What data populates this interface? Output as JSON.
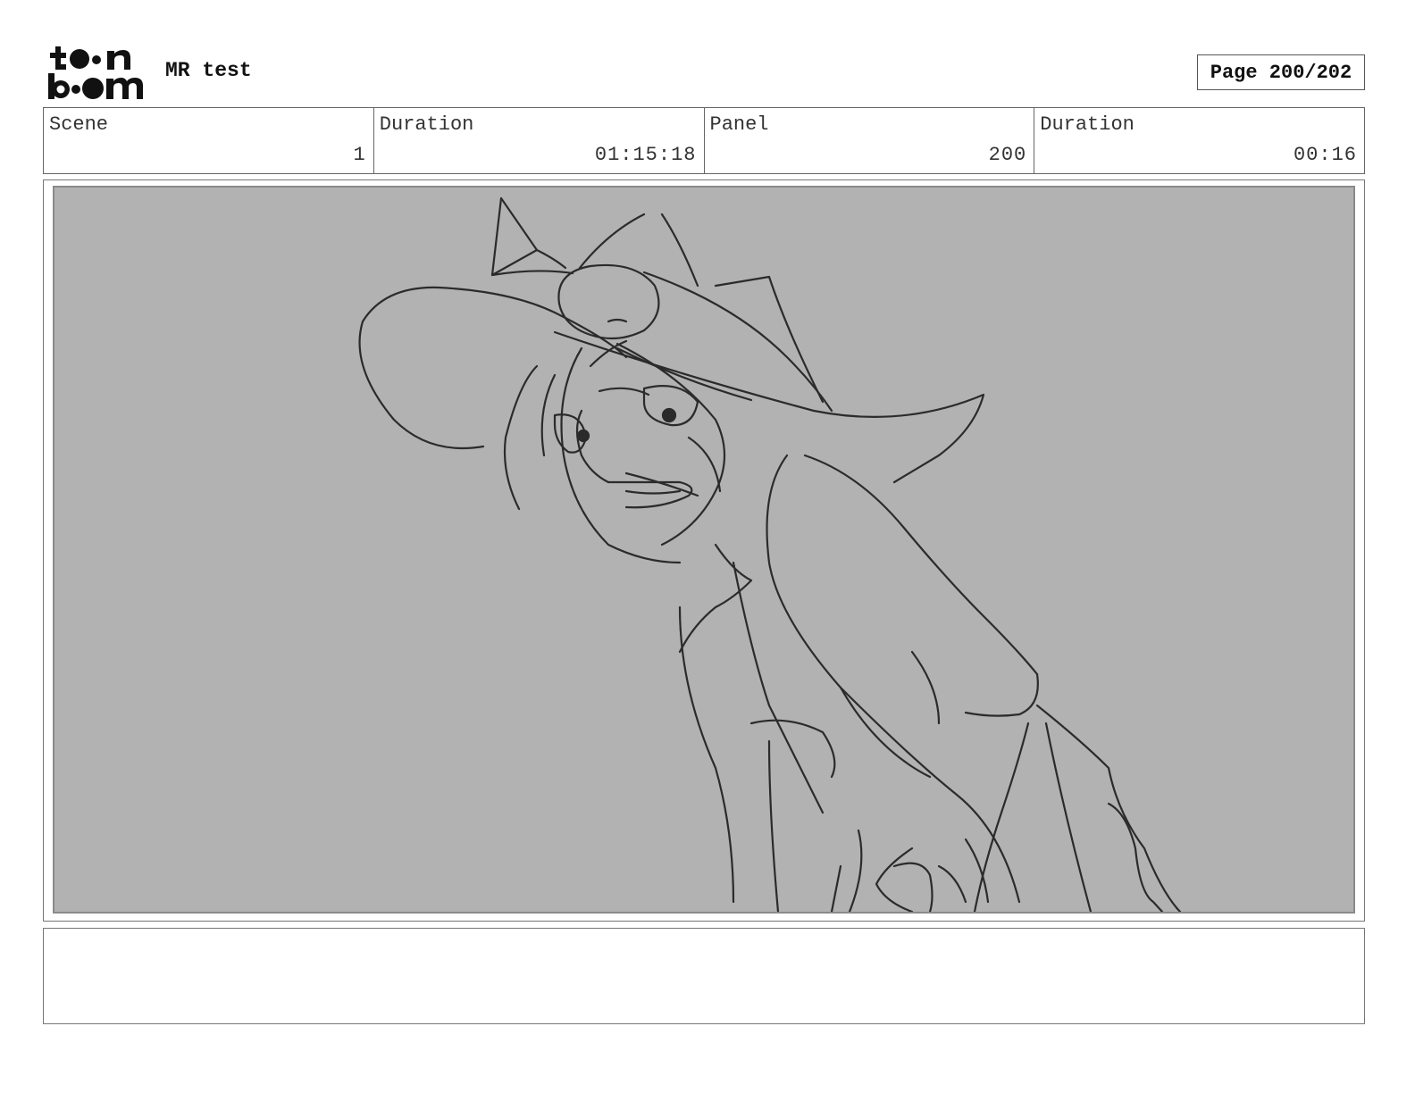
{
  "header": {
    "logo": "Toon Boom",
    "project_title": "MR test",
    "page_label": "Page 200/202"
  },
  "info": [
    {
      "label": "Scene",
      "value": "1"
    },
    {
      "label": "Duration",
      "value": "01:15:18"
    },
    {
      "label": "Panel",
      "value": "200"
    },
    {
      "label": "Duration",
      "value": "00:16"
    }
  ],
  "panel": {
    "background_color": "#b2b2b2",
    "sketch_color": "#2b2b2b"
  },
  "notes": {
    "text": ""
  }
}
